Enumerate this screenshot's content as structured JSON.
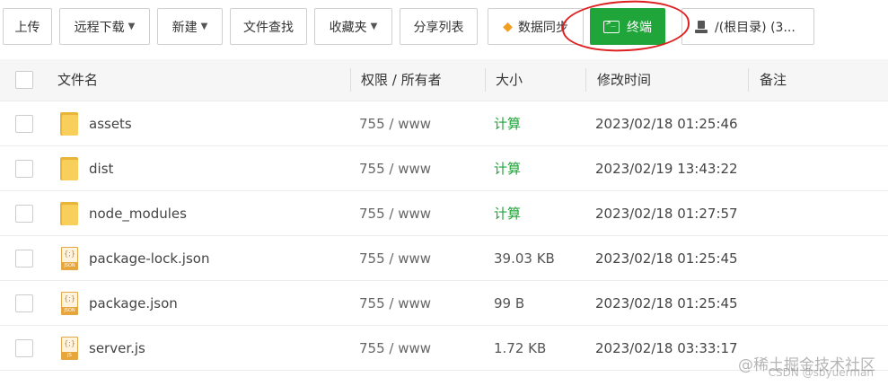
{
  "toolbar": {
    "upload": "上传",
    "remote_download": "远程下载",
    "new": "新建",
    "file_search": "文件查找",
    "favorites": "收藏夹",
    "share_list": "分享列表",
    "data_sync": "数据同步",
    "terminal": "终端",
    "path": "/(根目录) (3..."
  },
  "table": {
    "headers": {
      "name": "文件名",
      "permission": "权限 / 所有者",
      "size": "大小",
      "modified": "修改时间",
      "remark": "备注"
    },
    "rows": [
      {
        "name": "assets",
        "type": "folder",
        "permission": "755 / www",
        "size": "计算",
        "modified": "2023/02/18 01:25:46"
      },
      {
        "name": "dist",
        "type": "folder",
        "permission": "755 / www",
        "size": "计算",
        "modified": "2023/02/19 13:43:22"
      },
      {
        "name": "node_modules",
        "type": "folder",
        "permission": "755 / www",
        "size": "计算",
        "modified": "2023/02/18 01:27:57"
      },
      {
        "name": "package-lock.json",
        "type": "json",
        "permission": "755 / www",
        "size": "39.03 KB",
        "modified": "2023/02/18 01:25:45"
      },
      {
        "name": "package.json",
        "type": "json",
        "permission": "755 / www",
        "size": "99 B",
        "modified": "2023/02/18 01:25:45"
      },
      {
        "name": "server.js",
        "type": "js",
        "permission": "755 / www",
        "size": "1.72 KB",
        "modified": "2023/02/18 03:33:17"
      }
    ]
  },
  "file_icon_text": {
    "braces": "{;}",
    "json_tag": "JSON",
    "js_tag": "JS"
  },
  "watermark": {
    "main": "@稀土掘金技术社区",
    "sub": "CSDN @sbyuerman"
  },
  "colors": {
    "accent_green": "#20a53a",
    "annotation_red": "#e02020",
    "folder": "#f7cf5a"
  }
}
